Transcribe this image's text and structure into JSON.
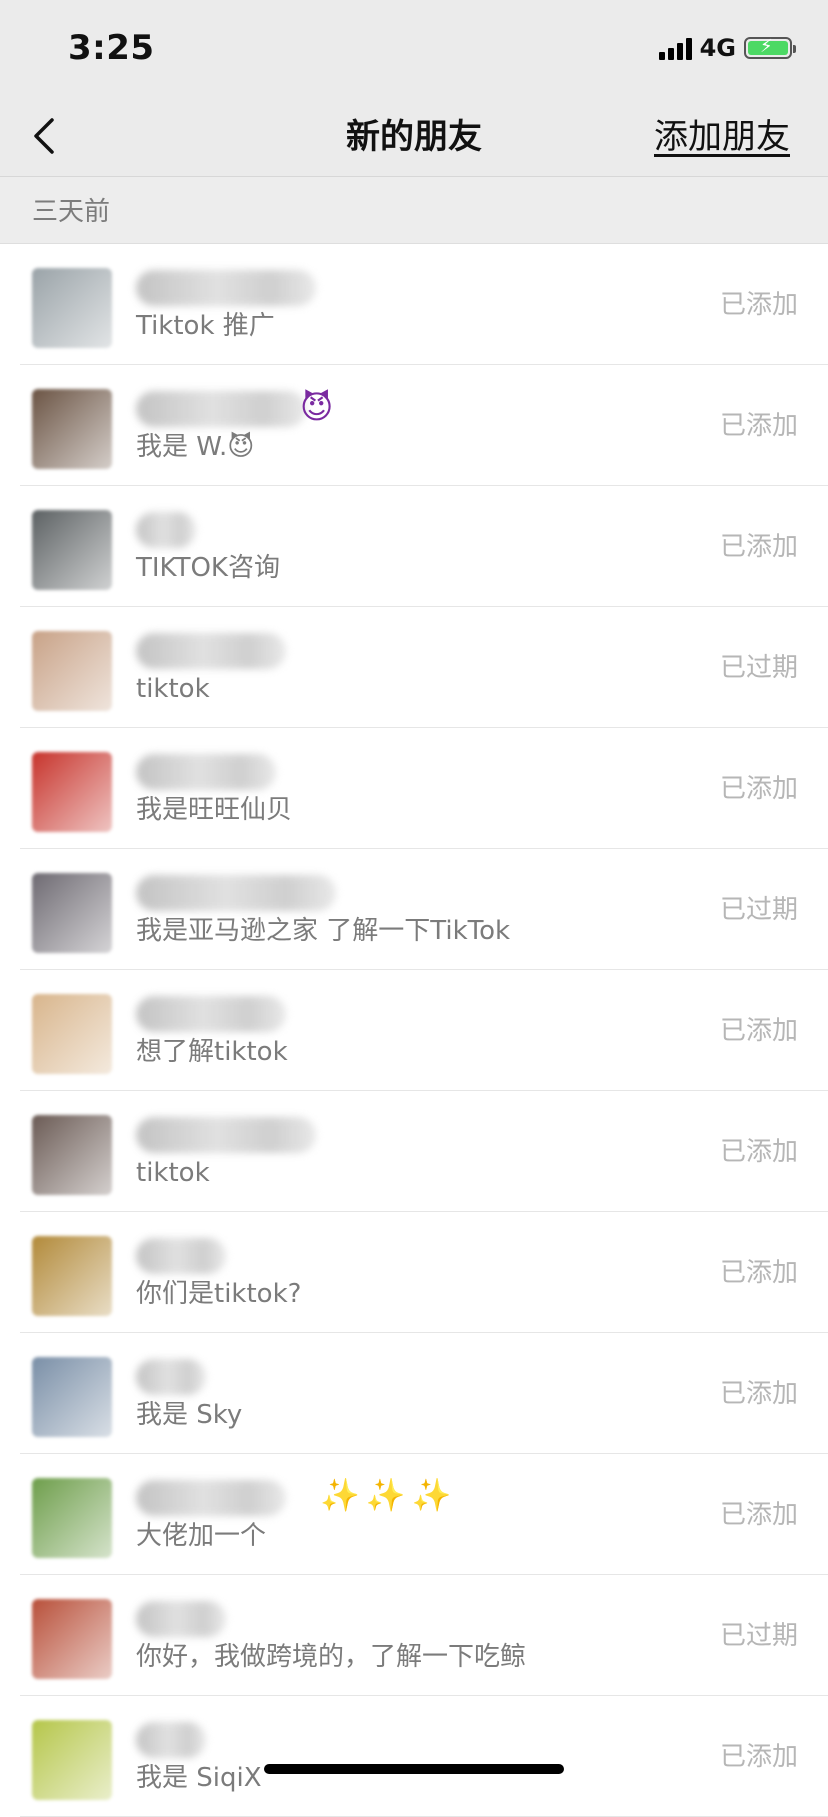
{
  "status_bar": {
    "time": "3:25",
    "network": "4G"
  },
  "nav": {
    "title": "新的朋友",
    "action": "添加朋友"
  },
  "section": {
    "label": "三天前"
  },
  "items": [
    {
      "message": "Tiktok 推广",
      "status": "已添加",
      "avatar_color": "#9aa3a8",
      "name_width": 180
    },
    {
      "message": "我是 W.😈",
      "status": "已添加",
      "avatar_color": "#6b5444",
      "name_width": 170,
      "name_suffix": "😈"
    },
    {
      "message": "TIKTOK咨询",
      "status": "已添加",
      "avatar_color": "#5c6163",
      "name_width": 60
    },
    {
      "message": "tiktok",
      "status": "已过期",
      "avatar_color": "#c8a287",
      "name_width": 150
    },
    {
      "message": "我是旺旺仙贝",
      "status": "已添加",
      "avatar_color": "#c7342c",
      "name_width": 140
    },
    {
      "message": "我是亚马逊之家  了解一下TikTok",
      "status": "已过期",
      "avatar_color": "#6e6a72",
      "name_width": 200
    },
    {
      "message": "想了解tiktok",
      "status": "已添加",
      "avatar_color": "#d8b58c",
      "name_width": 150
    },
    {
      "message": "tiktok",
      "status": "已添加",
      "avatar_color": "#6b5b55",
      "name_width": 180
    },
    {
      "message": "你们是tiktok?",
      "status": "已添加",
      "avatar_color": "#b28a3a",
      "name_width": 90
    },
    {
      "message": "我是 Sky",
      "status": "已添加",
      "avatar_color": "#7a8fa7",
      "name_width": 70
    },
    {
      "message": "大佬加一个",
      "status": "已添加",
      "avatar_color": "#6e9e4b",
      "name_width": 150,
      "name_suffix": "✨✨✨"
    },
    {
      "message": "你好，我做跨境的，了解一下吃鲸",
      "status": "已过期",
      "avatar_color": "#b8503a",
      "name_width": 90
    },
    {
      "message": "我是 SiqiX",
      "status": "已添加",
      "avatar_color": "#b5c64a",
      "name_width": 70
    }
  ]
}
